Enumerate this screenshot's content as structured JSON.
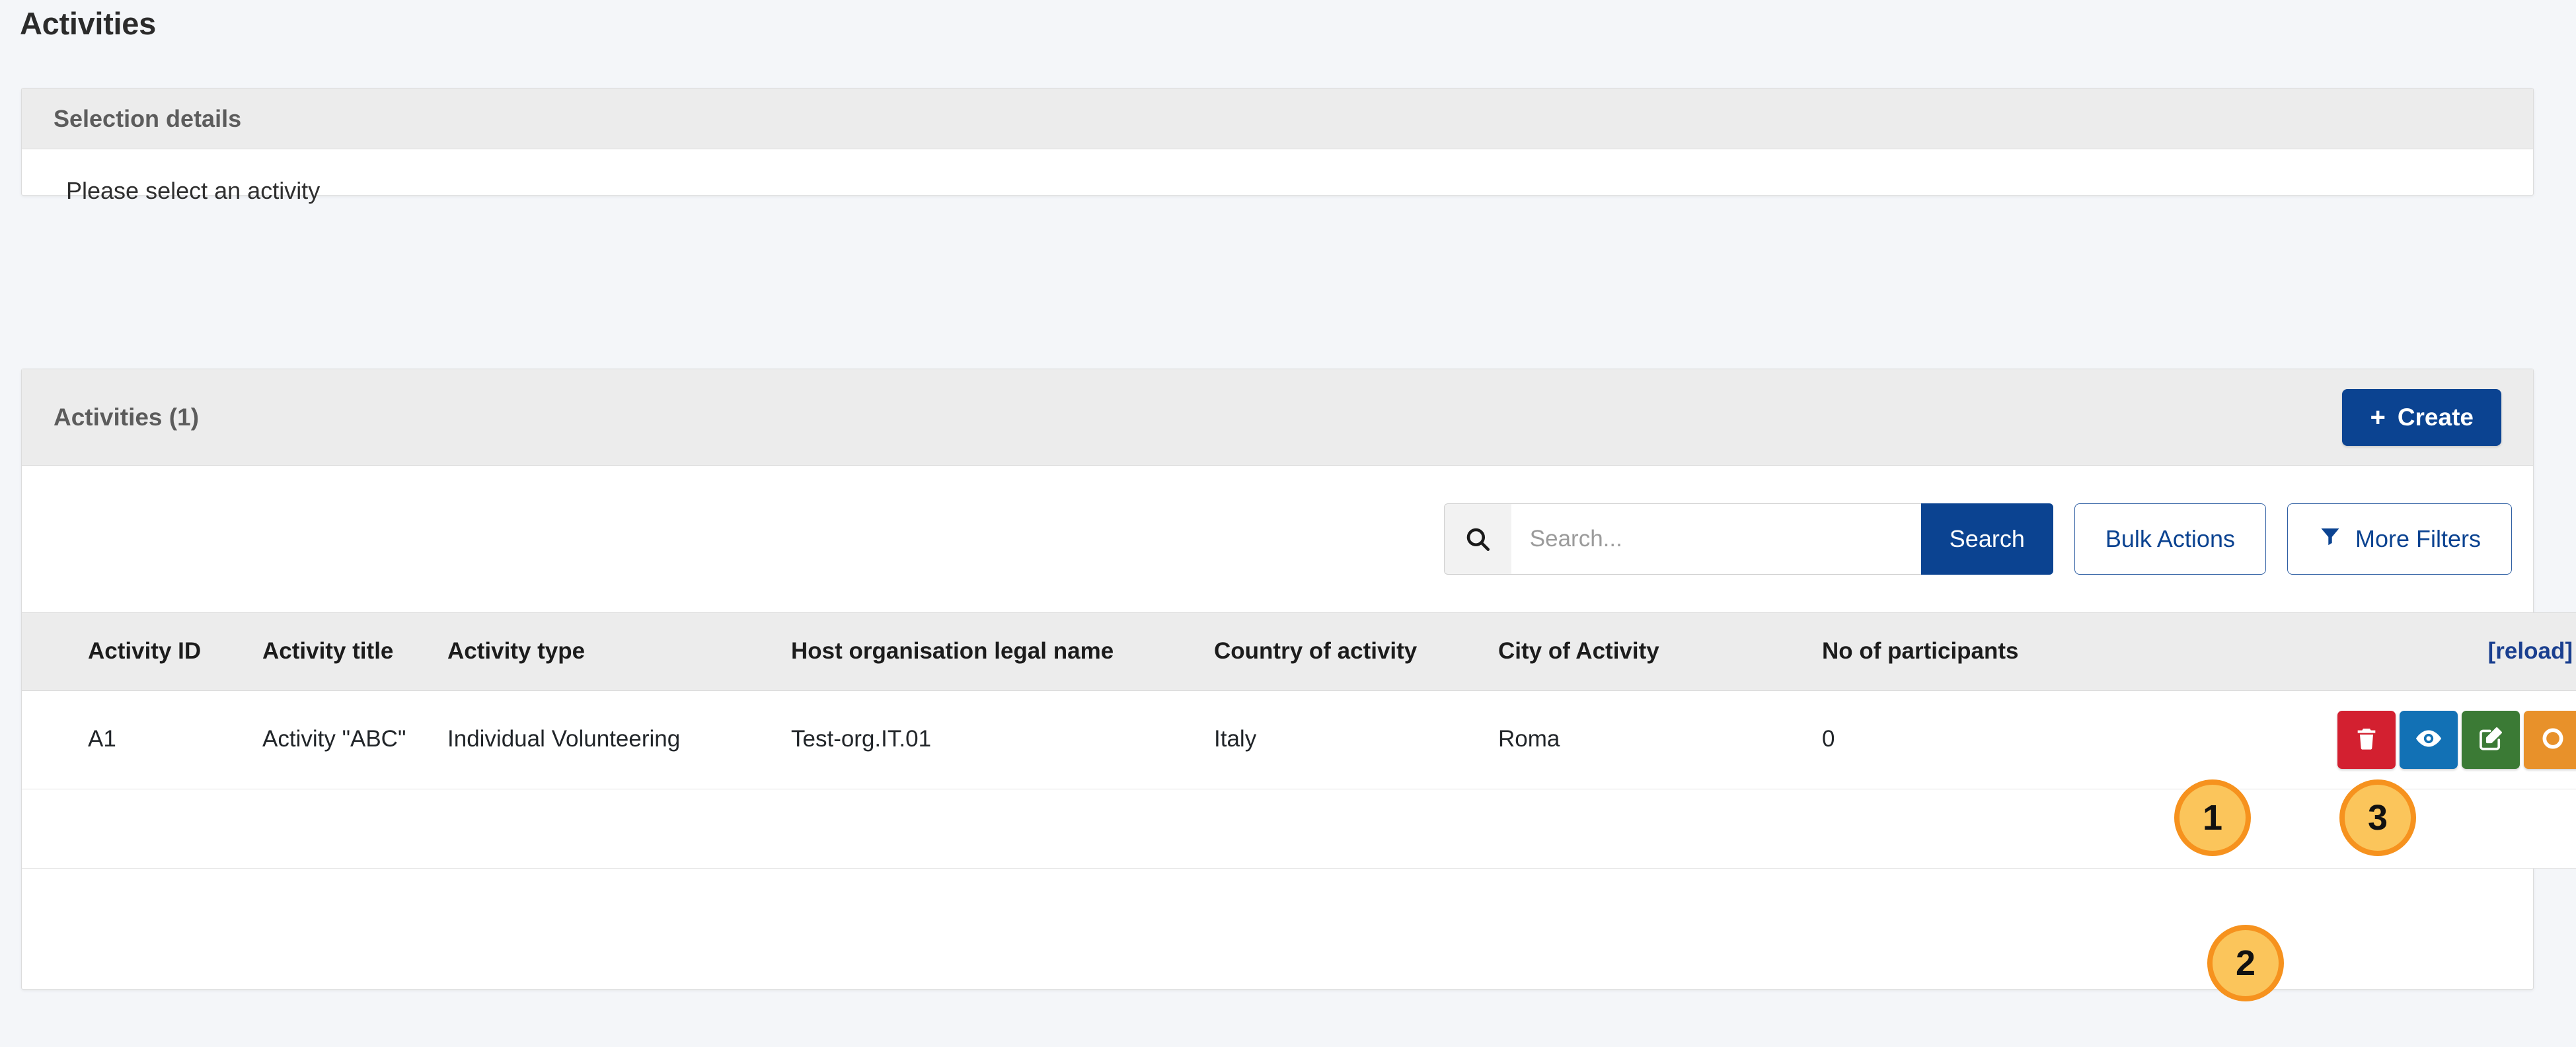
{
  "page": {
    "title": "Activities",
    "background_color": "#f4f6f9"
  },
  "selection_panel": {
    "header_title": "Selection details",
    "body_message": "Please select an activity"
  },
  "activities_panel": {
    "header_title": "Activities (1)",
    "create_button": {
      "label": "Create",
      "icon": "plus-icon",
      "color": "#0b4391"
    }
  },
  "toolbar": {
    "search": {
      "icon": "search-icon",
      "placeholder": "Search...",
      "value": "",
      "button_label": "Search",
      "button_color": "#0b4391"
    },
    "bulk_actions_label": "Bulk Actions",
    "more_filters_label": "More Filters",
    "more_filters_icon": "filter-icon",
    "outline_color": "#0b4391"
  },
  "table": {
    "columns": [
      "Activity ID",
      "Activity title",
      "Activity type",
      "Host organisation legal name",
      "Country of activity",
      "City of Activity",
      "No of participants"
    ],
    "reload_label": "[reload]",
    "rows": [
      {
        "activity_id": "A1",
        "activity_title": "Activity \"ABC\"",
        "activity_type": "Individual Volunteering",
        "host_organisation": "Test-org.IT.01",
        "country": "Italy",
        "city": "Roma",
        "participants": "0",
        "actions": [
          {
            "name": "delete",
            "icon": "trash-icon",
            "color": "#d32030"
          },
          {
            "name": "view",
            "icon": "eye-icon",
            "color": "#1271b5"
          },
          {
            "name": "edit",
            "icon": "pen-to-square-icon",
            "color": "#3b7a35"
          },
          {
            "name": "status",
            "icon": "circle-ring-icon",
            "color": "#e8912a"
          }
        ]
      }
    ]
  },
  "annotations": {
    "badge_fill": "#fbc55b",
    "badge_border": "#f6921e",
    "badges": [
      {
        "number": "1",
        "target": "delete-action-button"
      },
      {
        "number": "2",
        "target": "view-action-button"
      },
      {
        "number": "3",
        "target": "edit-action-button"
      }
    ]
  }
}
